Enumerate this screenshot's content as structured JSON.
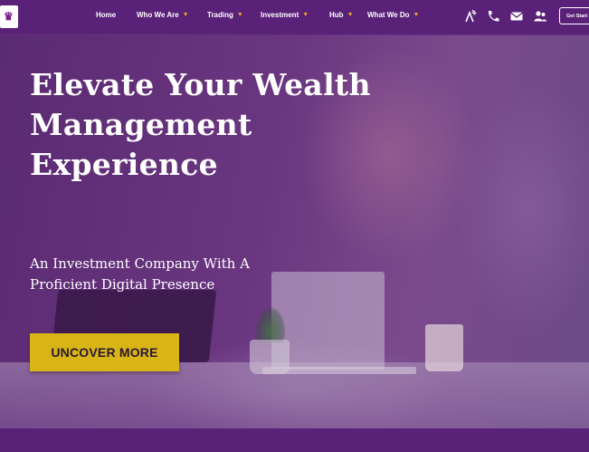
{
  "nav": {
    "items": [
      {
        "label": "Home",
        "dropdown": false
      },
      {
        "label": "Who We Are",
        "dropdown": true
      },
      {
        "label": "Trading",
        "dropdown": true
      },
      {
        "label": "Investment",
        "dropdown": true
      },
      {
        "label": "Hub",
        "dropdown": true
      },
      {
        "label": "What We Do",
        "dropdown": true
      }
    ],
    "icons": [
      "broadcast-icon",
      "phone-icon",
      "mail-icon",
      "user-group-icon"
    ],
    "cta_label": "Get Start"
  },
  "hero": {
    "headline_lines": [
      "Elevate Your Wealth",
      "Management",
      "Experience"
    ],
    "subheading_lines": [
      "An Investment Company With A",
      "Proficient Digital Presence"
    ],
    "button_label": "UNCOVER MORE"
  },
  "colors": {
    "brand_purple": "#5a2179",
    "accent_yellow": "#d8b514",
    "chevron_orange": "#e5a825"
  }
}
